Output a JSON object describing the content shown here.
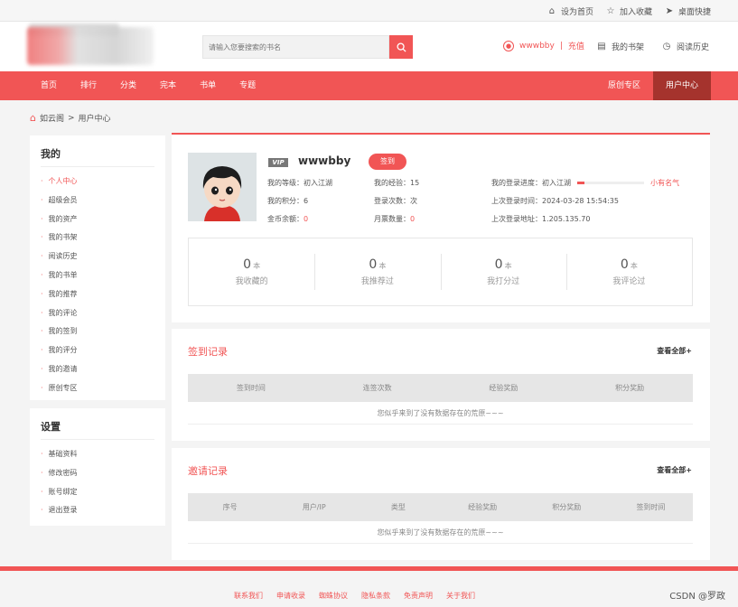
{
  "topbar": {
    "set_home": "设为首页",
    "add_favorite": "加入收藏",
    "desktop_shortcut": "桌面快捷"
  },
  "header": {
    "search_placeholder": "请输入您要搜索的书名",
    "username": "wwwbby",
    "separator": "|",
    "recharge": "充值",
    "bookshelf": "我的书架",
    "history": "阅读历史"
  },
  "nav": {
    "items": [
      "首页",
      "排行",
      "分类",
      "完本",
      "书单",
      "专题"
    ],
    "right": [
      "原创专区",
      "用户中心"
    ]
  },
  "breadcrumb": {
    "home": "如云阁",
    "sep": ">",
    "current": "用户中心"
  },
  "sidebar_my": {
    "title": "我的",
    "items": [
      "个人中心",
      "超级会员",
      "我的资产",
      "我的书架",
      "阅读历史",
      "我的书单",
      "我的推荐",
      "我的评论",
      "我的签到",
      "我的评分",
      "我的邀请",
      "原创专区"
    ]
  },
  "sidebar_settings": {
    "title": "设置",
    "items": [
      "基础资料",
      "修改密码",
      "账号绑定",
      "退出登录"
    ]
  },
  "profile": {
    "vip": "VIP",
    "username": "wwwbby",
    "sign_button": "签到",
    "level_label": "我的等级：",
    "level_value": "初入江湖",
    "points_label": "我的积分：",
    "points_value": "6",
    "gold_label": "金币余额：",
    "gold_value": "0",
    "exp_label": "我的经验：",
    "exp_value": "15",
    "login_count_label": "登录次数：",
    "login_count_value": "次",
    "monthly_ticket_label": "月票数量：",
    "monthly_ticket_value": "0",
    "progress_label": "我的登录进度：",
    "progress_from": "初入江湖",
    "progress_to": "小有名气",
    "progress_fraction": 0.12,
    "last_login_time_label": "上次登录时间：",
    "last_login_time_value": "2024-03-28 15:54:35",
    "last_login_ip_label": "上次登录地址：",
    "last_login_ip_value": "1.205.135.70"
  },
  "stats": [
    {
      "num": "0",
      "unit": "本",
      "label": "我收藏的"
    },
    {
      "num": "0",
      "unit": "本",
      "label": "我推荐过"
    },
    {
      "num": "0",
      "unit": "本",
      "label": "我打分过"
    },
    {
      "num": "0",
      "unit": "本",
      "label": "我评论过"
    }
  ],
  "signin_records": {
    "title": "签到记录",
    "more": "查看全部+",
    "columns": [
      "签到时间",
      "连签次数",
      "经验奖励",
      "积分奖励"
    ],
    "empty": "您似乎来到了没有数据存在的荒原~~~"
  },
  "invite_records": {
    "title": "邀请记录",
    "more": "查看全部+",
    "columns": [
      "序号",
      "用户/IP",
      "类型",
      "经验奖励",
      "积分奖励",
      "签到时间"
    ],
    "empty": "您似乎来到了没有数据存在的荒原~~~"
  },
  "footer": {
    "links": [
      "联系我们",
      "申请收录",
      "蜘蛛协议",
      "隐私条款",
      "免责声明",
      "关于我们"
    ]
  },
  "watermark": "CSDN @罗政",
  "colors": {
    "brand_red": "#f15555",
    "active_nav": "#a5332d"
  }
}
